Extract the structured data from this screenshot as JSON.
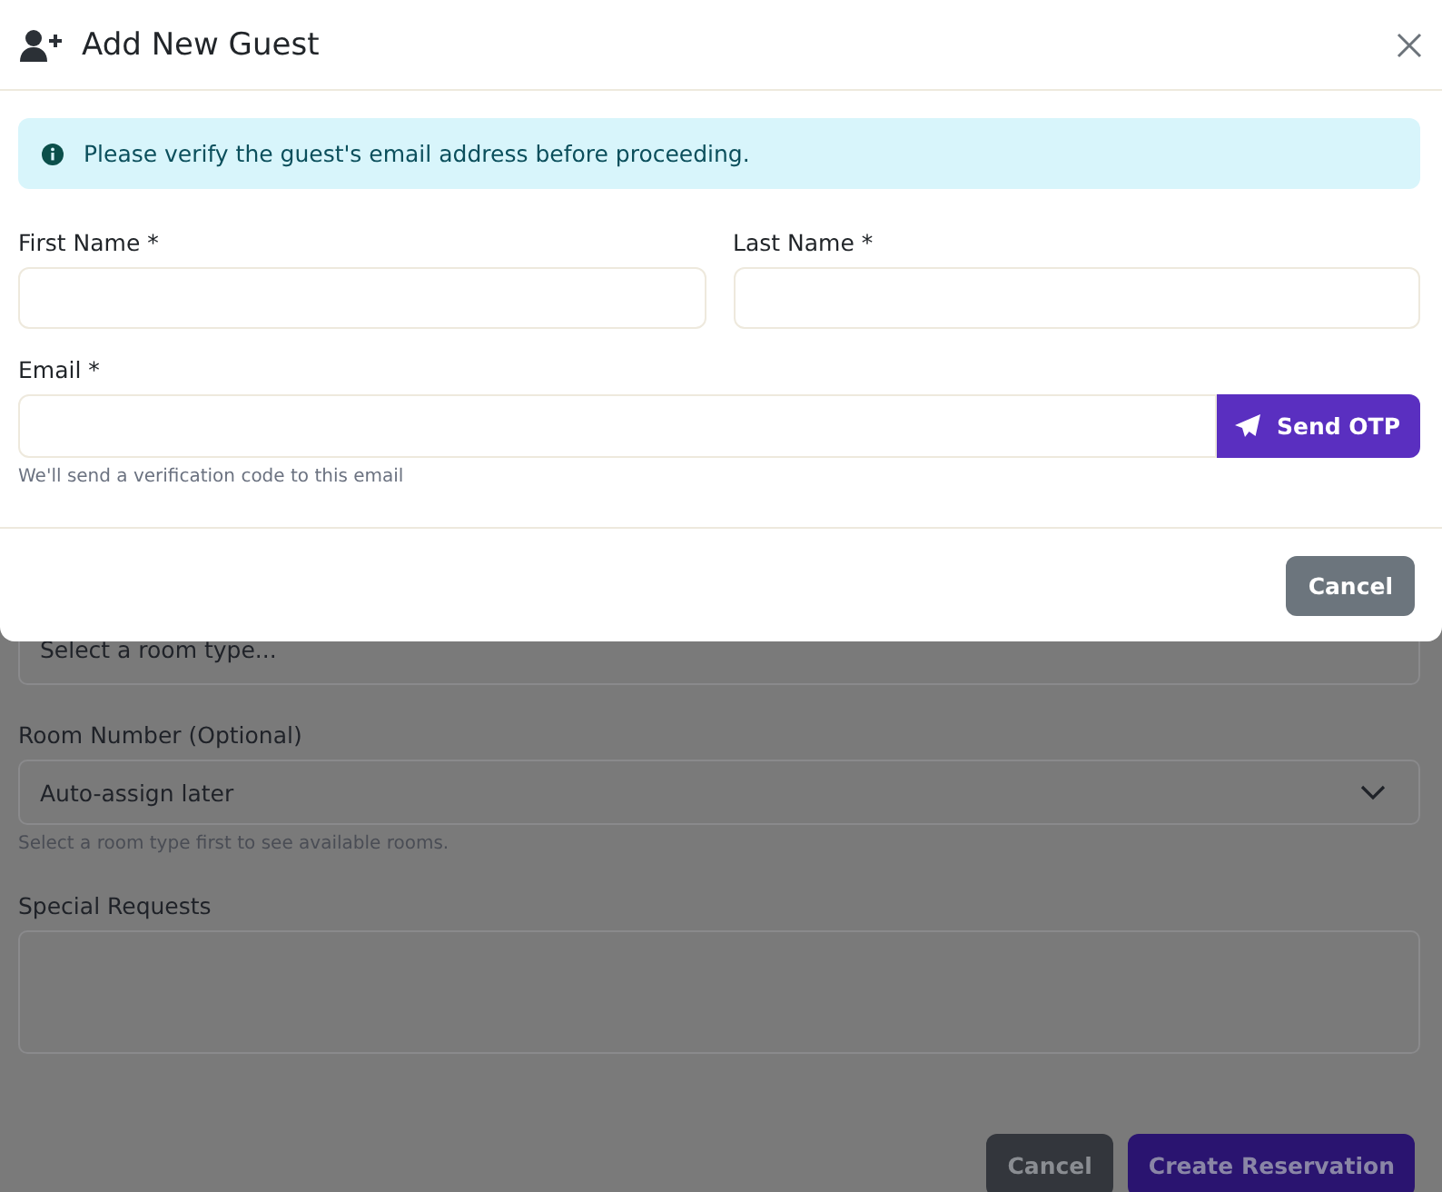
{
  "modal": {
    "title": "Add New Guest",
    "alert": "Please verify the guest's email address before proceeding.",
    "fields": [
      {
        "label": "First Name *"
      },
      {
        "label": "Last Name *"
      }
    ],
    "email": {
      "label": "Email *",
      "button": "Send OTP",
      "help": "We'll send a verification code to this email"
    },
    "cancel": "Cancel"
  },
  "background": {
    "room_type": {
      "placeholder": "Select a room type..."
    },
    "room_number": {
      "label": "Room Number (Optional)",
      "value": "Auto-assign later",
      "help": "Select a room type first to see available rooms."
    },
    "special_requests": {
      "label": "Special Requests"
    },
    "buttons": [
      "Cancel",
      "Create Reservation"
    ]
  }
}
